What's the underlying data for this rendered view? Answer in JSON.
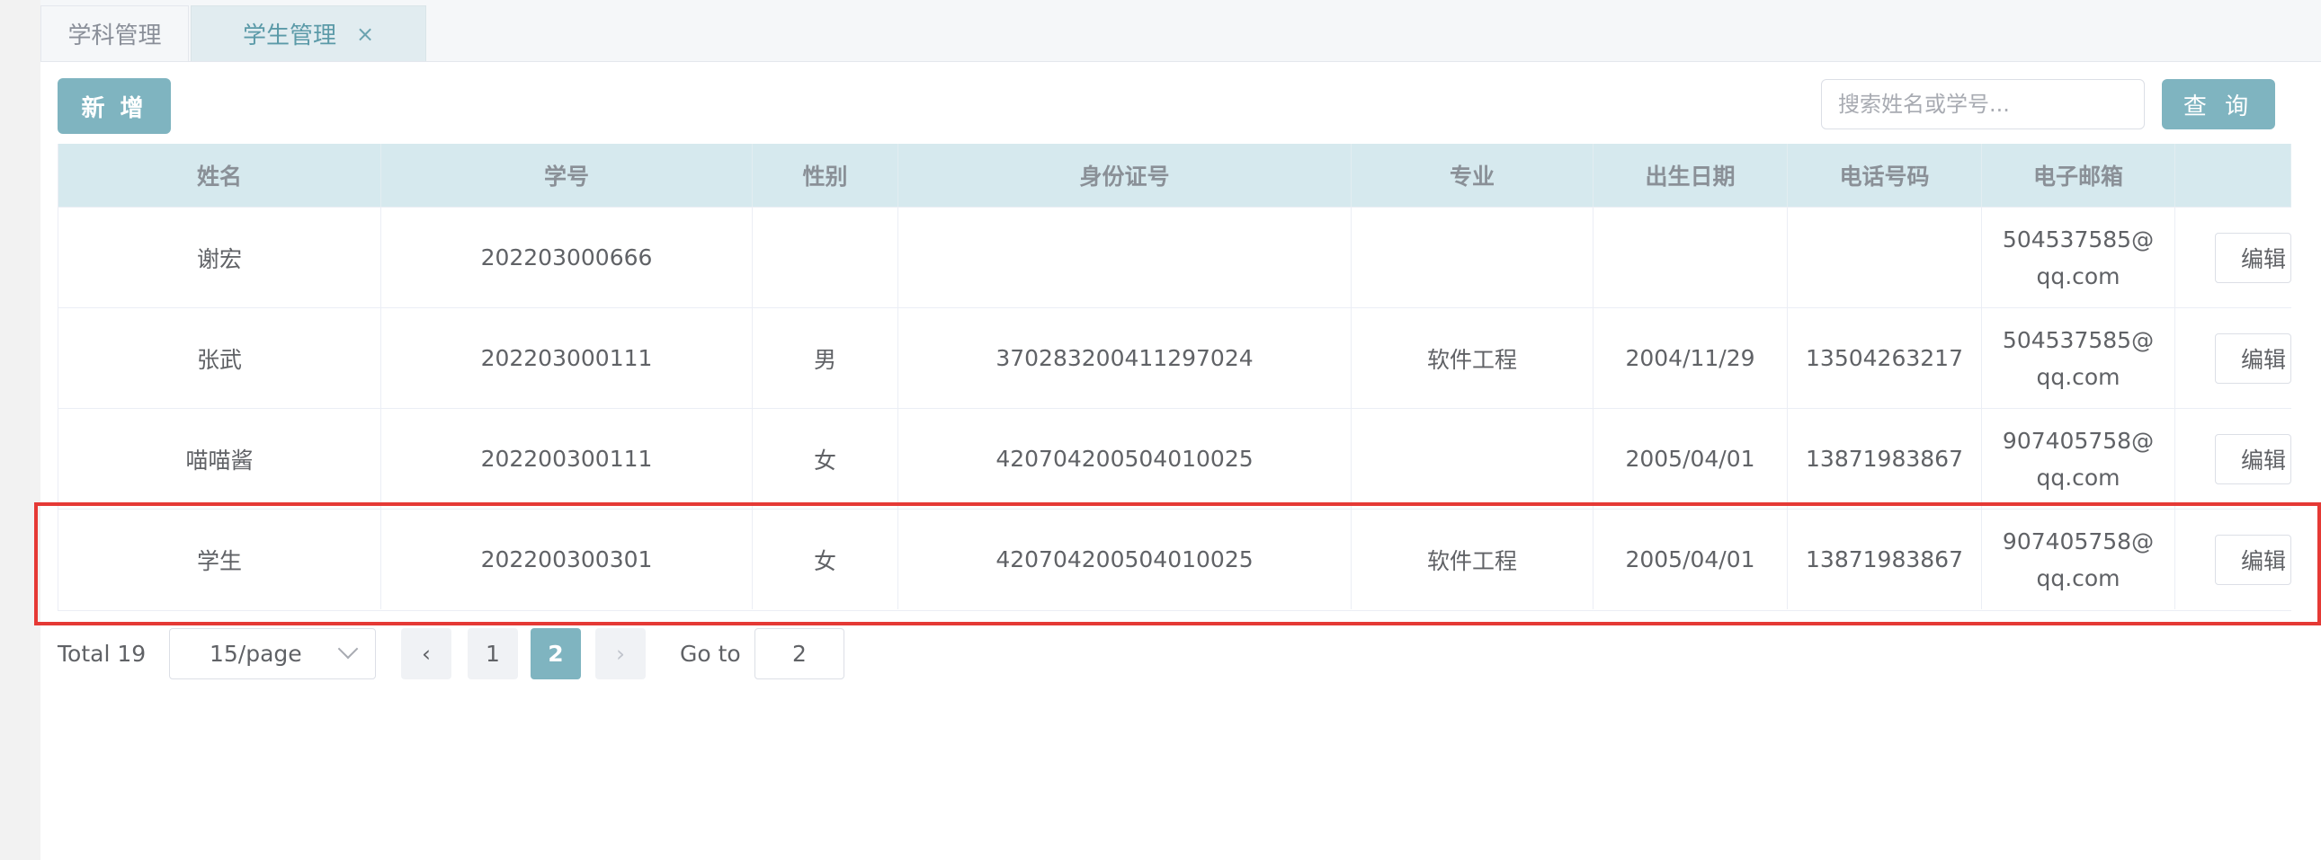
{
  "tabs": [
    {
      "label": "学科管理"
    },
    {
      "label": "学生管理",
      "close": "×"
    }
  ],
  "toolbar": {
    "add_label": "新 增",
    "search_placeholder": "搜索姓名或学号...",
    "search_value": "",
    "query_label": "查 询"
  },
  "table": {
    "columns": [
      "姓名",
      "学号",
      "性别",
      "身份证号",
      "专业",
      "出生日期",
      "电话号码",
      "电子邮箱",
      ""
    ],
    "rows": [
      {
        "name": "谢宏",
        "student_id": "202203000666",
        "gender": "",
        "id_card": "",
        "major": "",
        "birth": "",
        "phone": "",
        "email": "504537585@qq.com",
        "action": "编辑"
      },
      {
        "name": "张武",
        "student_id": "202203000111",
        "gender": "男",
        "id_card": "370283200411297024",
        "major": "软件工程",
        "birth": "2004/11/29",
        "phone": "13504263217",
        "email": "504537585@qq.com",
        "action": "编辑"
      },
      {
        "name": "喵喵酱",
        "student_id": "202200300111",
        "gender": "女",
        "id_card": "420704200504010025",
        "major": "",
        "birth": "2005/04/01",
        "phone": "13871983867",
        "email": "907405758@qq.com",
        "action": "编辑"
      },
      {
        "name": "学生",
        "student_id": "202200300301",
        "gender": "女",
        "id_card": "420704200504010025",
        "major": "软件工程",
        "birth": "2005/04/01",
        "phone": "13871983867",
        "email": "907405758@qq.com",
        "action": "编辑"
      }
    ]
  },
  "pagination": {
    "total": "Total 19",
    "page_size": "15/page",
    "prev": "‹",
    "pages": [
      "1",
      "2"
    ],
    "current": "2",
    "next": "›",
    "goto_label": "Go to",
    "goto_value": "2"
  },
  "colors": {
    "accent": "#7fb4c0",
    "header_bg": "#d6e9ee",
    "highlight": "#e53935"
  }
}
